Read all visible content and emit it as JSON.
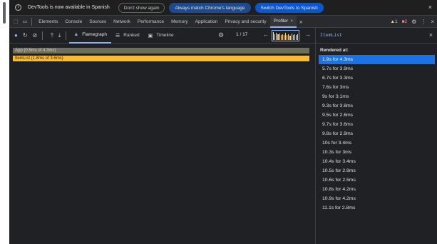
{
  "infobar": {
    "icon": "info-icon",
    "message": "DevTools is now available in Spanish",
    "dont_show": "Don't show again",
    "always_match": "Always match Chrome's language",
    "switch_to": "Switch DevTools to Spanish",
    "close": "×"
  },
  "tabbar": {
    "inspect_icon": "⬚",
    "device_icon": "▭",
    "tabs": [
      "Elements",
      "Console",
      "Sources",
      "Network",
      "Performance",
      "Memory",
      "Application",
      "Privacy and security",
      "Profiler"
    ],
    "active_tab": "Profiler",
    "active_close": "×",
    "more": "»",
    "warnings": "1",
    "errors": "2",
    "settings_icon": "⚙",
    "menu_icon": "⋮",
    "close_icon": "×"
  },
  "profiler": {
    "record_icon": "●",
    "reload_icon": "↻",
    "clear_icon": "⊘",
    "load_icon": "⤒",
    "save_icon": "⤓",
    "tabs": {
      "flamegraph": "Flamegraph",
      "ranked": "Ranked",
      "timeline": "Timeline"
    },
    "settings_icon": "⚙",
    "commit_current": "1",
    "commit_separator": "/",
    "commit_total": "17",
    "prev_icon": "←",
    "next_icon": "→",
    "commit_bars": [
      0.95,
      0.7,
      0.8,
      0.65,
      0.75,
      0.6,
      0.7,
      0.55,
      0.85,
      0.6,
      0.7,
      0.5,
      0.75,
      0.6,
      0.65,
      0.55,
      0.7
    ],
    "colors": {
      "accent": "#8ab4f8",
      "commit": "#fdd663",
      "app_bar": "#6e6e5a",
      "itemlist_bar": "#f9bb34",
      "selected_row": "#1a73e8"
    }
  },
  "flamegraph": {
    "app_bar": "App (0.5ms of 4.3ms)",
    "itemlist_bar": "ItemList (1.8ms of 3.6ms)"
  },
  "sidebar": {
    "component": "ItemList",
    "close": "×",
    "rendered_at_label": "Rendered at:",
    "renders": [
      "1.9s for 4.3ms",
      "5.7s for 3.9ms",
      "6.7s for 3.3ms",
      "7.6s for 3ms",
      "9s for 3.1ms",
      "9.3s for 3.8ms",
      "9.5s for 2.6ms",
      "9.7s for 3.6ms",
      "9.8s for 2.9ms",
      "10s for 3.4ms",
      "10.3s for 3ms",
      "10.4s for 3.4ms",
      "10.5s for 2.9ms",
      "10.6s for 2.5ms",
      "10.8s for 4.2ms",
      "10.9s for 4.2ms",
      "11.1s for 2.8ms"
    ],
    "selected_index": 0
  }
}
